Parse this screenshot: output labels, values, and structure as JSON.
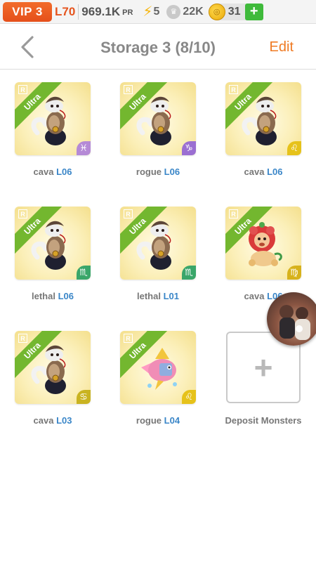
{
  "status": {
    "vip": "VIP 3",
    "level": "L70",
    "pr_value": "969.1K",
    "pr_label": "PR",
    "energy": "5",
    "crowns": "22K",
    "coins": "31",
    "add_label": "+"
  },
  "header": {
    "back_icon": "chevron-left-icon",
    "title": "Storage 3 (8/10)",
    "edit_label": "Edit"
  },
  "monsters": [
    {
      "name": "cava",
      "level": "L06",
      "rarity": "Ultra",
      "rank": "R",
      "zodiac": "♓",
      "zodiac_color": "#b58ad6",
      "kind": "snake"
    },
    {
      "name": "rogue",
      "level": "L06",
      "rarity": "Ultra",
      "rank": "R",
      "zodiac": "♑",
      "zodiac_color": "#9b6fd2",
      "kind": "snake"
    },
    {
      "name": "cava",
      "level": "L06",
      "rarity": "Ultra",
      "rank": "R",
      "zodiac": "♌",
      "zodiac_color": "#e6c21a",
      "kind": "snake"
    },
    {
      "name": "lethal",
      "level": "L06",
      "rarity": "Ultra",
      "rank": "R",
      "zodiac": "♏",
      "zodiac_color": "#3aa66a",
      "kind": "snake"
    },
    {
      "name": "lethal",
      "level": "L01",
      "rarity": "Ultra",
      "rank": "R",
      "zodiac": "♏",
      "zodiac_color": "#3aa66a",
      "kind": "snake"
    },
    {
      "name": "cava",
      "level": "L06",
      "rarity": "Ultra",
      "rank": "R",
      "zodiac": "♍",
      "zodiac_color": "#d7b21c",
      "kind": "lion"
    },
    {
      "name": "cava",
      "level": "L03",
      "rarity": "Ultra",
      "rank": "R",
      "zodiac": "♋",
      "zodiac_color": "#c9b321",
      "kind": "snake"
    },
    {
      "name": "rogue",
      "level": "L04",
      "rarity": "Ultra",
      "rank": "R",
      "zodiac": "♌",
      "zodiac_color": "#e6c21a",
      "kind": "fish"
    }
  ],
  "deposit": {
    "label": "Deposit Monsters",
    "plus": "+"
  },
  "colors": {
    "accent": "#ef7a23",
    "level_blue": "#3a86c8",
    "ribbon_green": "#73b72f",
    "vip_orange": "#e5501b"
  }
}
